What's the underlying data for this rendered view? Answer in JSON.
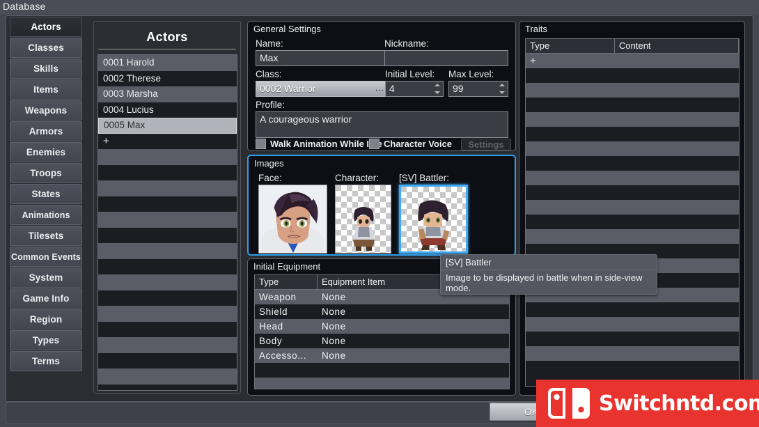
{
  "window": {
    "title": "Database",
    "ok_label": "OK"
  },
  "sidebar": {
    "items": [
      {
        "label": "Actors",
        "selected": true
      },
      {
        "label": "Classes",
        "selected": false
      },
      {
        "label": "Skills",
        "selected": false
      },
      {
        "label": "Items",
        "selected": false
      },
      {
        "label": "Weapons",
        "selected": false
      },
      {
        "label": "Armors",
        "selected": false
      },
      {
        "label": "Enemies",
        "selected": false
      },
      {
        "label": "Troops",
        "selected": false
      },
      {
        "label": "States",
        "selected": false
      },
      {
        "label": "Animations",
        "selected": false
      },
      {
        "label": "Tilesets",
        "selected": false
      },
      {
        "label": "Common Events",
        "selected": false
      },
      {
        "label": "System",
        "selected": false
      },
      {
        "label": "Game Info",
        "selected": false
      },
      {
        "label": "Region",
        "selected": false
      },
      {
        "label": "Types",
        "selected": false
      },
      {
        "label": "Terms",
        "selected": false
      }
    ]
  },
  "actors_list": {
    "title": "Actors",
    "items": [
      {
        "label": "0001 Harold",
        "selected": false
      },
      {
        "label": "0002 Therese",
        "selected": false
      },
      {
        "label": "0003 Marsha",
        "selected": false
      },
      {
        "label": "0004 Lucius",
        "selected": false
      },
      {
        "label": "0005 Max",
        "selected": true
      },
      {
        "label": "+",
        "selected": false
      }
    ],
    "empty_rows": 15
  },
  "general_settings": {
    "group_title": "General Settings",
    "name_label": "Name:",
    "name_value": "Max",
    "nickname_label": "Nickname:",
    "nickname_value": "",
    "class_label": "Class:",
    "class_value": "0002 Warrior",
    "class_browse": "...",
    "initial_level_label": "Initial Level:",
    "initial_level_value": "4",
    "max_level_label": "Max Level:",
    "max_level_value": "99",
    "profile_label": "Profile:",
    "profile_value": "A courageous warrior",
    "walk_anim_label": "Walk Animation While Idle",
    "walk_anim_checked": false,
    "character_voice_label": "Character Voice",
    "character_voice_checked": false,
    "settings_button_label": "Settings",
    "settings_button_enabled": false
  },
  "images": {
    "group_title": "Images",
    "focused": true,
    "slots": [
      {
        "label": "Face:",
        "kind": "face",
        "focused": false
      },
      {
        "label": "Character:",
        "kind": "character",
        "focused": false
      },
      {
        "label": "[SV] Battler:",
        "kind": "battler",
        "focused": true
      }
    ]
  },
  "initial_equipment": {
    "group_title": "Initial Equipment",
    "columns": [
      "Type",
      "Equipment Item"
    ],
    "rows": [
      {
        "type": "Weapon",
        "item": "None"
      },
      {
        "type": "Shield",
        "item": "None"
      },
      {
        "type": "Head",
        "item": "None"
      },
      {
        "type": "Body",
        "item": "None"
      },
      {
        "type": "Accesso...",
        "item": "None"
      }
    ],
    "empty_rows": 2
  },
  "traits": {
    "group_title": "Traits",
    "columns": [
      "Type",
      "Content"
    ],
    "rows": [
      {
        "type": "+",
        "content": ""
      }
    ],
    "empty_rows": 21
  },
  "tooltip": {
    "title": "[SV] Battler",
    "body": "Image to be displayed in battle when in side-view mode."
  },
  "watermark": {
    "text": "Switchntd.com",
    "icon": "nintendo-switch-icon",
    "color": "#e8332f"
  },
  "colors": {
    "accent_focus": "#3fa9f5",
    "panel_bg": "#0d0f14",
    "window_bg": "#2b2d33",
    "row_odd": "#5a5d65",
    "row_even": "#1b1d22",
    "selected_row": "#b0b3ba"
  }
}
